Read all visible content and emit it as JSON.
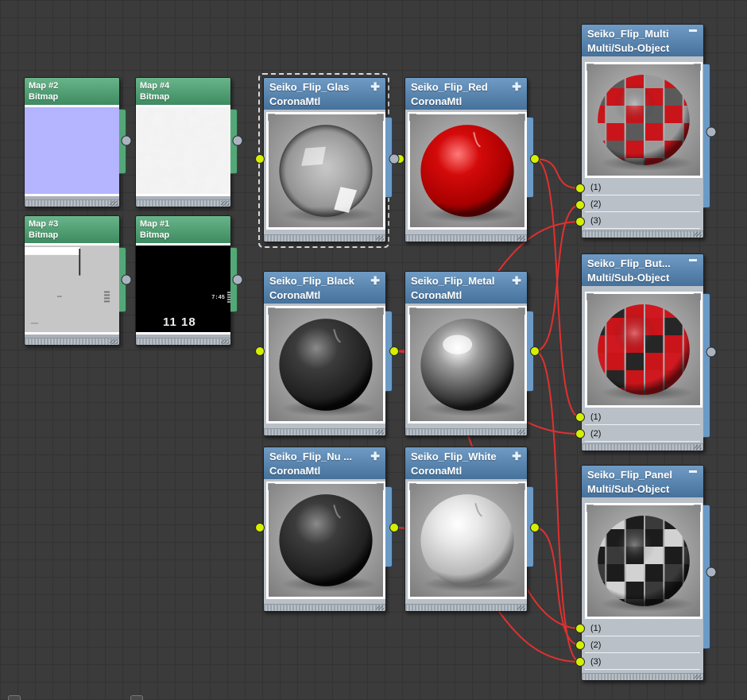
{
  "maps": [
    {
      "id": "map2",
      "title": "Map #2",
      "type": "Bitmap",
      "preview": "lavender"
    },
    {
      "id": "map4",
      "title": "Map #4",
      "type": "Bitmap",
      "preview": "white-noise"
    },
    {
      "id": "map3",
      "title": "Map #3",
      "type": "Bitmap",
      "preview": "gray-layout"
    },
    {
      "id": "map1",
      "title": "Map #1",
      "type": "Bitmap",
      "preview": "black-dial",
      "dial_small": "7:45",
      "dial_big": "11 18"
    }
  ],
  "materials": [
    {
      "id": "glas",
      "title": "Seiko_Flip_Glas",
      "type": "CoronaMtl",
      "preview": "glass"
    },
    {
      "id": "red",
      "title": "Seiko_Flip_Red",
      "type": "CoronaMtl",
      "preview": "red"
    },
    {
      "id": "black",
      "title": "Seiko_Flip_Black",
      "type": "CoronaMtl",
      "preview": "black"
    },
    {
      "id": "metal",
      "title": "Seiko_Flip_Metal",
      "type": "CoronaMtl",
      "preview": "metal"
    },
    {
      "id": "nu",
      "title": "Seiko_Flip_Nu ...",
      "type": "CoronaMtl",
      "preview": "black2"
    },
    {
      "id": "white",
      "title": "Seiko_Flip_White",
      "type": "CoronaMtl",
      "preview": "white"
    }
  ],
  "multis": [
    {
      "id": "multi",
      "title": "Seiko_Flip_Multi",
      "type": "Multi/Sub-Object",
      "slots": [
        "(1)",
        "(2)",
        "(3)"
      ],
      "preview": "checker-red-metal"
    },
    {
      "id": "but",
      "title": "Seiko_Flip_But...",
      "type": "Multi/Sub-Object",
      "slots": [
        "(1)",
        "(2)"
      ],
      "preview": "checker-red-black"
    },
    {
      "id": "panel",
      "title": "Seiko_Flip_Panel",
      "type": "Multi/Sub-Object",
      "slots": [
        "(1)",
        "(2)",
        "(3)"
      ],
      "preview": "checker-black-white"
    }
  ],
  "colors": {
    "canvas_bg": "#3b3b3b",
    "material_header": "#5f8ab4",
    "map_header": "#56a27a",
    "wire": "#e03030",
    "socket": "#d4f000"
  }
}
